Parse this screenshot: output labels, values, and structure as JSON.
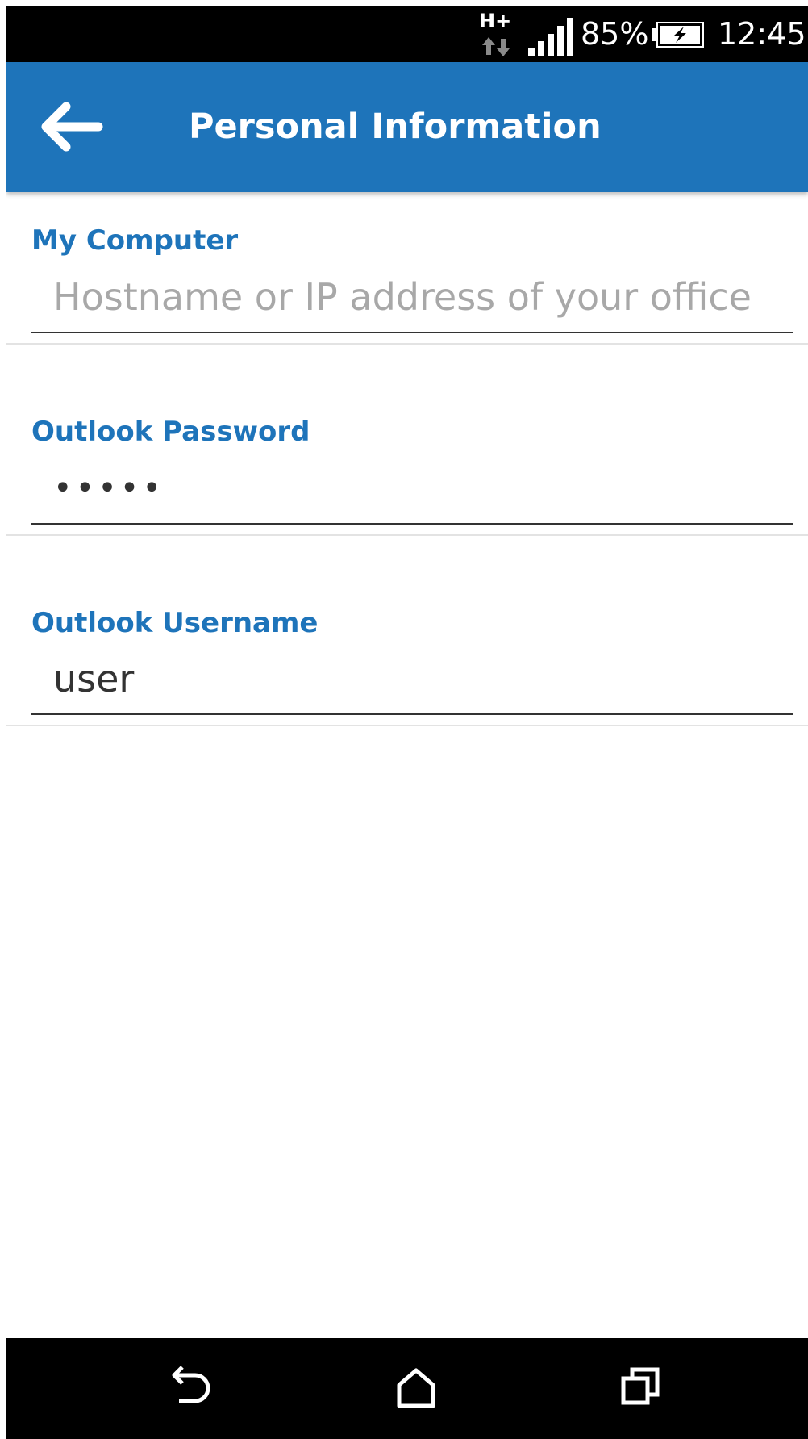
{
  "status_bar": {
    "network_type": "H+",
    "battery_percent": "85%",
    "time": "12:45",
    "icons": [
      "network-type-icon",
      "signal-icon",
      "battery-charging-icon"
    ]
  },
  "app_bar": {
    "title": "Personal Information",
    "back_icon": "arrow-left-icon",
    "background_color": "#1e74ba"
  },
  "form": {
    "my_computer": {
      "label": "My Computer",
      "value": "",
      "placeholder": "Hostname or IP address of your office"
    },
    "outlook_password": {
      "label": "Outlook Password",
      "value": "•••••",
      "placeholder": ""
    },
    "outlook_username": {
      "label": "Outlook Username",
      "value": "user",
      "placeholder": ""
    },
    "label_color": "#1e74ba"
  },
  "nav_bar": {
    "icons": [
      "back-icon",
      "home-icon",
      "recents-icon"
    ]
  }
}
